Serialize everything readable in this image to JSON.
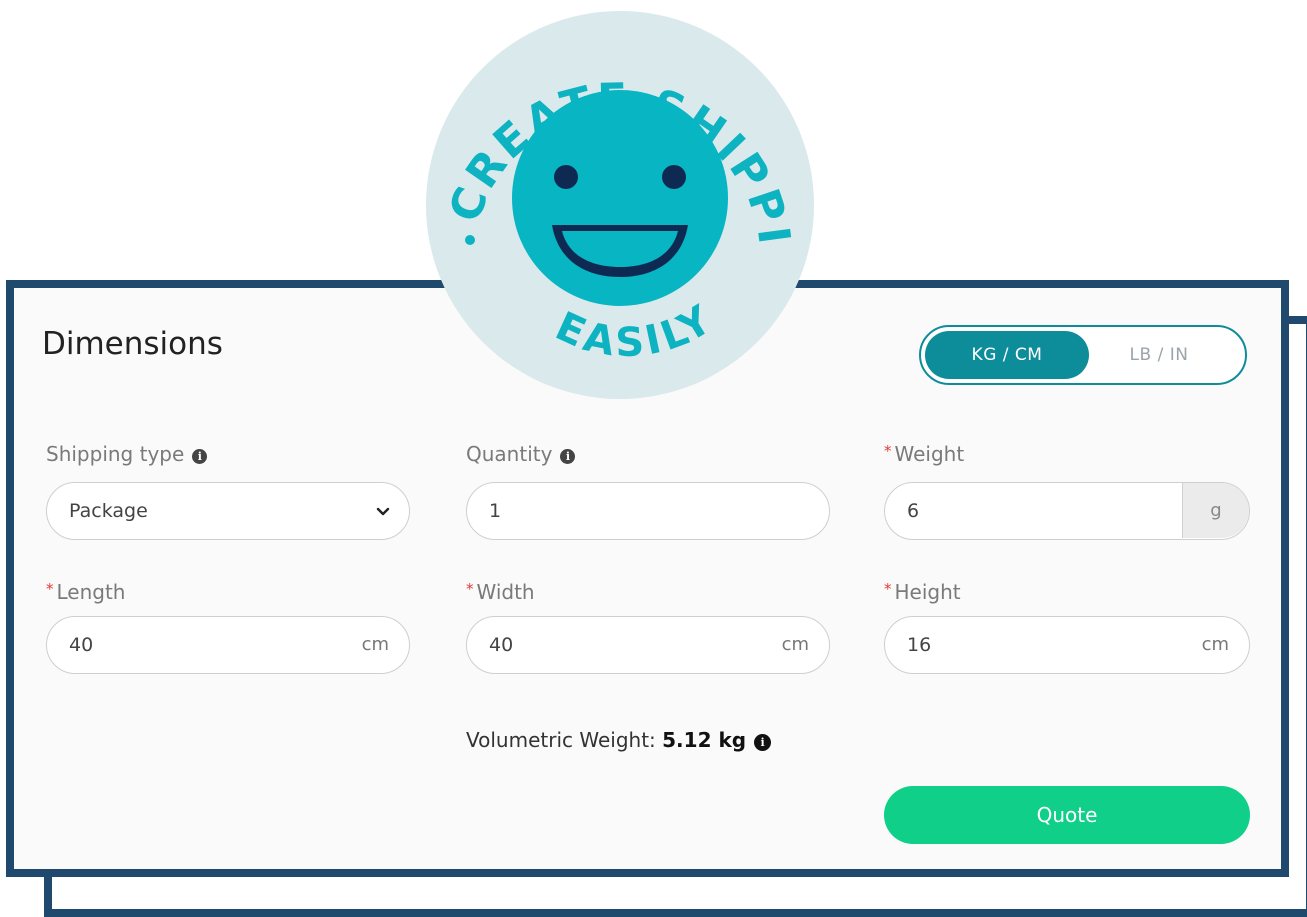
{
  "badge": {
    "top_text": "CREATE SHIPPING LABELS",
    "bottom_text": "EASILY",
    "icon": "smiley-face-icon",
    "colors": {
      "ring": "#d9e9ec",
      "face": "#07b5c3",
      "text": "#0db3c1",
      "features": "#0f2a52"
    }
  },
  "card": {
    "title": "Dimensions",
    "unit_toggle": {
      "active": "KG / CM",
      "inactive": "LB / IN"
    },
    "fields": {
      "shipping_type": {
        "label": "Shipping type",
        "value": "Package",
        "info_icon": "info-icon"
      },
      "quantity": {
        "label": "Quantity",
        "value": "1",
        "info_icon": "info-icon"
      },
      "weight": {
        "required": "*",
        "label": "Weight",
        "value": "6",
        "unit": "g"
      },
      "length": {
        "required": "*",
        "label": "Length",
        "value": "40",
        "unit": "cm"
      },
      "width": {
        "required": "*",
        "label": "Width",
        "value": "40",
        "unit": "cm"
      },
      "height": {
        "required": "*",
        "label": "Height",
        "value": "16",
        "unit": "cm"
      }
    },
    "volumetric": {
      "label": "Volumetric Weight:",
      "value": "5.12 kg"
    },
    "quote_label": "Quote"
  },
  "colors": {
    "frame": "#1f4a6e",
    "accent": "#0d8c9a",
    "primary_button": "#10cf88",
    "required": "#e53935"
  }
}
